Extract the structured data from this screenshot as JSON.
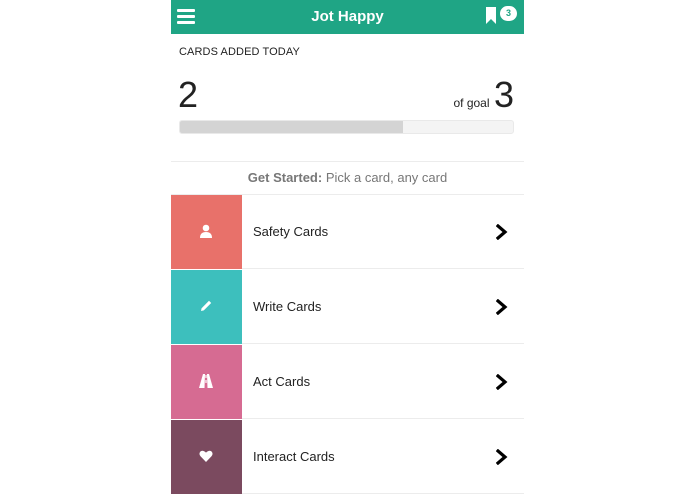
{
  "header": {
    "title": "Jot Happy",
    "badge_count": "3",
    "bg_color": "#1fa585"
  },
  "progress": {
    "label": "CARDS ADDED TODAY",
    "count": "2",
    "goal_prefix": "of goal",
    "goal": "3",
    "fraction": 0.67
  },
  "intro": {
    "bold": "Get Started:",
    "rest": " Pick a card, any card"
  },
  "cards": [
    {
      "label": "Safety Cards",
      "color": "#e8716a",
      "icon": "person-icon"
    },
    {
      "label": "Write Cards",
      "color": "#3dbfbd",
      "icon": "pencil-icon"
    },
    {
      "label": "Act Cards",
      "color": "#d66b92",
      "icon": "road-icon"
    },
    {
      "label": "Interact Cards",
      "color": "#7b4a5f",
      "icon": "heart-icon"
    }
  ]
}
